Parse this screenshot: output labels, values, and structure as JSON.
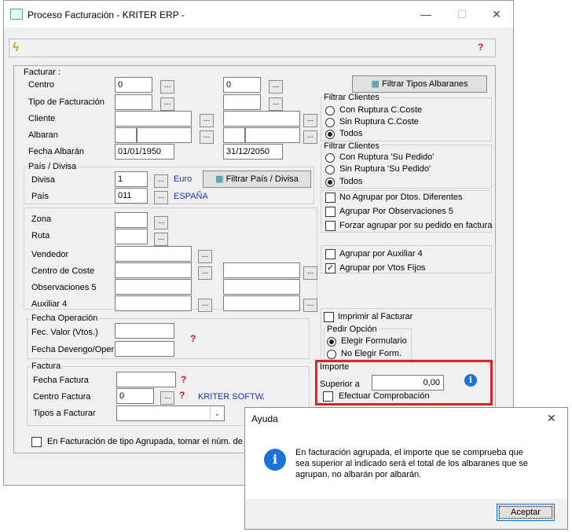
{
  "window": {
    "title": "Proceso Facturación - KRITER ERP -",
    "minimize": "—",
    "maximize": "☐",
    "close": "✕"
  },
  "toolbar": {
    "run_icon": "lightning-icon",
    "help_icon": "help-icon"
  },
  "facturar": {
    "title": "Facturar :",
    "centro_label": "Centro",
    "centro_from": "0",
    "centro_to": "0",
    "tipo_label": "Tipo de Facturación",
    "cliente_label": "Cliente",
    "albaran_label": "Albaran",
    "fecha_albaran_label": "Fecha Albarán",
    "fecha_from": "01/01/1950",
    "fecha_to": "31/12/2050",
    "filtrar_tipos_btn": "Filtrar Tipos Albaranes",
    "dots": "..."
  },
  "pais_divisa": {
    "title": "País / Divisa",
    "divisa_label": "Divisa",
    "divisa_value": "1",
    "divisa_name": "Euro",
    "pais_label": "País",
    "pais_value": "011",
    "pais_name": "ESPAÑA",
    "filtrar_btn": "Filtrar País / Divisa"
  },
  "other_fields": {
    "zona": "Zona",
    "ruta": "Ruta",
    "vendedor": "Vendedor",
    "centro_coste": "Centro de Coste",
    "observaciones": "Observaciones 5",
    "auxiliar": "Auxiliar 4"
  },
  "fecha_operacion": {
    "title": "Fecha Operación",
    "fec_valor": "Fec. Valor (Vtos.)",
    "fecha_devengo": "Fecha Devengo/Oper"
  },
  "factura": {
    "title": "Factura",
    "fecha_label": "Fecha Factura",
    "centro_label": "Centro Factura",
    "centro_value": "0",
    "centro_name": "KRITER SOFTWA",
    "tipos_label": "Tipos a Facturar",
    "tipos_value": ""
  },
  "bottom_check": "En Facturación de tipo Agrupada, tomar el núm. de Fac",
  "filtrar_clientes_1": {
    "title": "Filtrar Clientes",
    "options": [
      "Con Ruptura C.Coste",
      "Sin Ruptura C.Coste",
      "Todos"
    ],
    "selected": "Todos"
  },
  "filtrar_clientes_2": {
    "title": "Filtrar Clientes",
    "options": [
      "Con Ruptura 'Su Pedido'",
      "Sin Ruptura 'Su Pedido'",
      "Todos"
    ],
    "selected": "Todos"
  },
  "checks": {
    "no_agrupar": "No Agrupar por Dtos. Diferentes",
    "agrupar_obs": "Agrupar Por Observaciones 5",
    "forzar": "Forzar agrupar por su pedido en factura",
    "agrupar_aux": "Agrupar por Auxiliar 4",
    "agrupar_vtos": "Agrupar por Vtos Fijos",
    "imprimir": "Imprimir al Facturar"
  },
  "pedir_opcion": {
    "title": "Pedir Opción",
    "options": [
      "Elegir Formulario",
      "No Elegir Form."
    ],
    "selected": "Elegir Formulario"
  },
  "importe": {
    "title": "Importe",
    "superior_label": "Superior a",
    "superior_value": "0,00",
    "efectuar": "Efectuar Comprobación",
    "info_icon": "info-icon"
  },
  "dialog": {
    "title": "Ayuda",
    "close": "✕",
    "message_line1": "En facturación agrupada, el importe que se comprueba que",
    "message_line2": "sea superior al indicado será el total de los albaranes  que se",
    "message_line3": "agrupan, no albarán por albarán.",
    "ok_button": "Aceptar"
  },
  "colors": {
    "highlight": "#e0202a",
    "link_blue": "#1a33b3",
    "info_blue": "#1a73d9"
  }
}
